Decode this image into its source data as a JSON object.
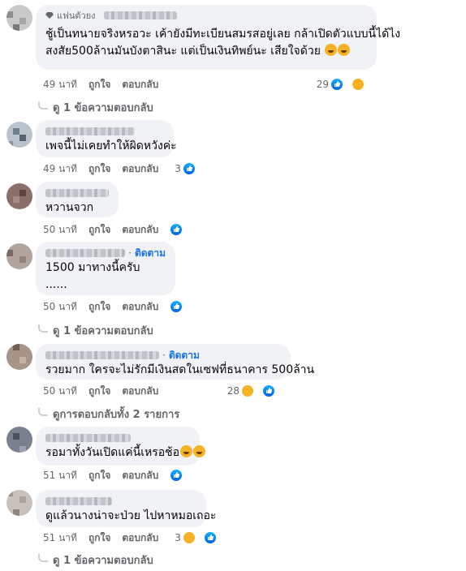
{
  "comments": [
    {
      "badge": "แฟนตัวยง",
      "lines": [
        "ชู้เป็นทนายจริงหรอวะ เค้ายังมีทะเบียนสมรสอยู่เลย กล้าเปิดตัวแบบนี้ได้ไง",
        "สงสัย500ล้านมันบังตาสินะ แต่เป็นเงินทิพย์นะ เสียใจด้วย"
      ],
      "time": "49 นาที",
      "like": "ถูกใจ",
      "reply": "ตอบกลับ",
      "reaction_count": "29",
      "reactions": [
        "like",
        "haha"
      ],
      "view_replies": "ดู 1 ข้อความตอบกลับ"
    },
    {
      "lines": [
        "เพจนี้ไม่เคยทำให้ผิดหวังค่ะ"
      ],
      "time": "49 นาที",
      "like": "ถูกใจ",
      "reply": "ตอบกลับ",
      "reaction_count": "3",
      "reactions": [
        "like"
      ]
    },
    {
      "lines": [
        "หวานจวก"
      ],
      "time": "50 นาที",
      "like": "ถูกใจ",
      "reply": "ตอบกลับ",
      "reaction_count": "",
      "reactions": [
        "like"
      ]
    },
    {
      "follow": "ติดตาม",
      "lines": [
        "1500 มาทางนี้ครับ",
        "......"
      ],
      "time": "50 นาที",
      "like": "ถูกใจ",
      "reply": "ตอบกลับ",
      "reaction_count": "",
      "reactions": [
        "like"
      ],
      "view_replies": "ดู 1 ข้อความตอบกลับ"
    },
    {
      "follow": "ติดตาม",
      "lines": [
        "รวยมาก ใครจะไม่รักมีเงินสดในเซฟที่ธนาคาร 500ล้าน"
      ],
      "time": "50 นาที",
      "like": "ถูกใจ",
      "reply": "ตอบกลับ",
      "reaction_count": "28",
      "reactions": [
        "haha",
        "like"
      ],
      "view_replies": "ดูการตอบกลับทั้ง 2 รายการ"
    },
    {
      "lines": [
        "รอมาทั้งวันเปิดแค่นี้เหรอช้อ"
      ],
      "time": "51 นาที",
      "like": "ถูกใจ",
      "reply": "ตอบกลับ",
      "reaction_count": "",
      "reactions": [
        "like"
      ]
    },
    {
      "lines": [
        "ดูแล้วนางน่าจะป่วย ไปหาหมอเถอะ"
      ],
      "time": "51 นาที",
      "like": "ถูกใจ",
      "reply": "ตอบกลับ",
      "reaction_count": "3",
      "reactions": [
        "haha",
        "like"
      ],
      "view_replies": "ดู 1 ข้อความตอบกลับ"
    }
  ],
  "colors": {
    "accent": "#1b74e4",
    "bubble": "#f0f2f5",
    "meta": "#65676b"
  }
}
